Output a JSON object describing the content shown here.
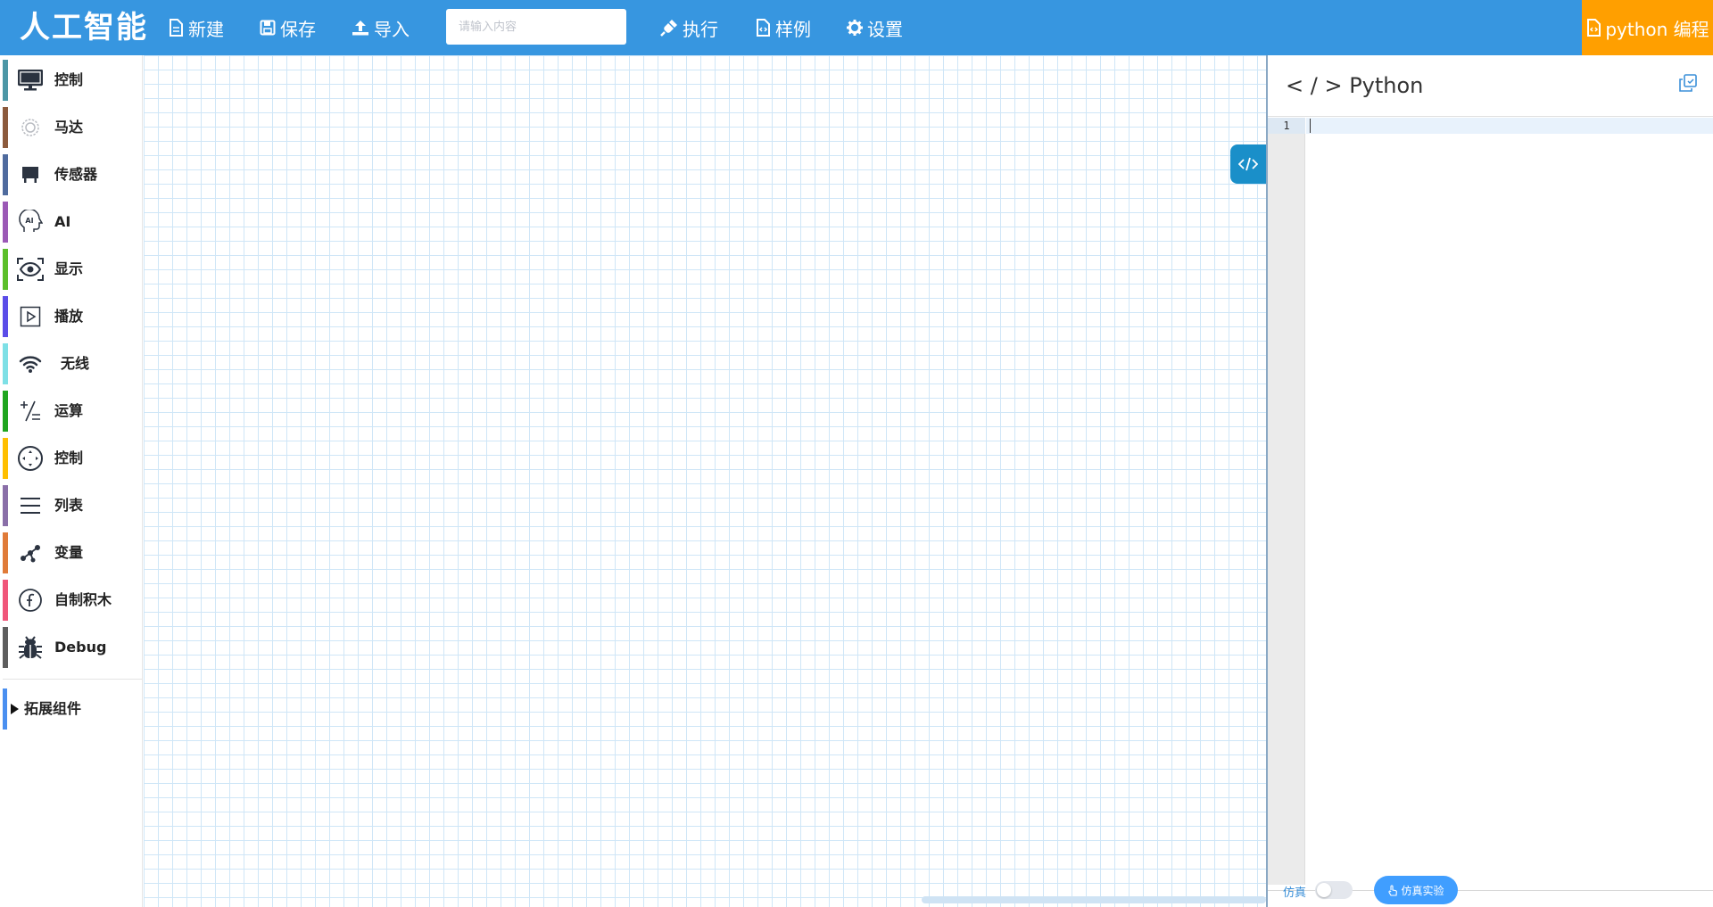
{
  "header": {
    "logo": "人工智能",
    "new_label": "新建",
    "save_label": "保存",
    "import_label": "导入",
    "search_placeholder": "请输入内容",
    "run_label": "执行",
    "examples_label": "样例",
    "settings_label": "设置",
    "python_label": "python 编程"
  },
  "sidebar": {
    "categories": [
      {
        "label": "控制",
        "icon": "monitor-icon",
        "color": "#4c97a6"
      },
      {
        "label": "马达",
        "icon": "motor-icon",
        "color": "#8c5a3c"
      },
      {
        "label": "传感器",
        "icon": "sensor-icon",
        "color": "#4f6b9e"
      },
      {
        "label": "AI",
        "icon": "ai-head-icon",
        "color": "#9b59b6"
      },
      {
        "label": "显示",
        "icon": "eye-icon",
        "color": "#5cbf2a"
      },
      {
        "label": "播放",
        "icon": "play-icon",
        "color": "#5b4de8"
      },
      {
        "label": "无线",
        "icon": "wifi-icon",
        "color": "#7ee0e6"
      },
      {
        "label": "运算",
        "icon": "math-icon",
        "color": "#1fa51f"
      },
      {
        "label": "控制",
        "icon": "control-icon",
        "color": "#ffbf00"
      },
      {
        "label": "列表",
        "icon": "list-icon",
        "color": "#8a6fa8"
      },
      {
        "label": "变量",
        "icon": "variable-icon",
        "color": "#e07b39"
      },
      {
        "label": "自制积木",
        "icon": "function-icon",
        "color": "#f0567a"
      },
      {
        "label": "Debug",
        "icon": "bug-icon",
        "color": "#5e5e5e"
      }
    ],
    "extensions_label": "拓展组件"
  },
  "code_panel": {
    "title": "< / > Python",
    "line_number": "1"
  },
  "footer": {
    "sim_toggle_label": "仿真",
    "sim_button_label": "仿真实验"
  }
}
